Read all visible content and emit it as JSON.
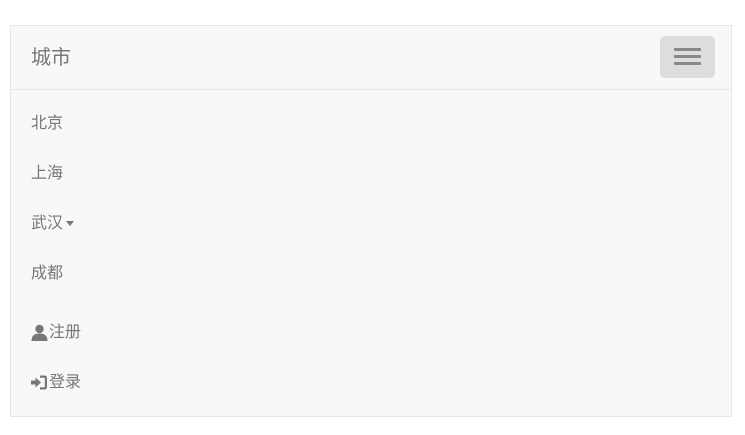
{
  "navbar": {
    "brand": "城市",
    "toggle_icon": "hamburger-menu-icon",
    "cities": [
      {
        "label": "北京"
      },
      {
        "label": "上海"
      },
      {
        "label": "武汉",
        "has_dropdown": true
      },
      {
        "label": "成都"
      }
    ],
    "account": {
      "register": {
        "label": "注册",
        "icon": "user-icon"
      },
      "login": {
        "label": "登录",
        "icon": "log-in-icon"
      }
    }
  },
  "colors": {
    "navbar_bg": "#f8f8f8",
    "navbar_border": "#e7e7e7",
    "link_text": "#777777",
    "toggle_bg": "#dddddd",
    "toggle_bar": "#888888"
  }
}
